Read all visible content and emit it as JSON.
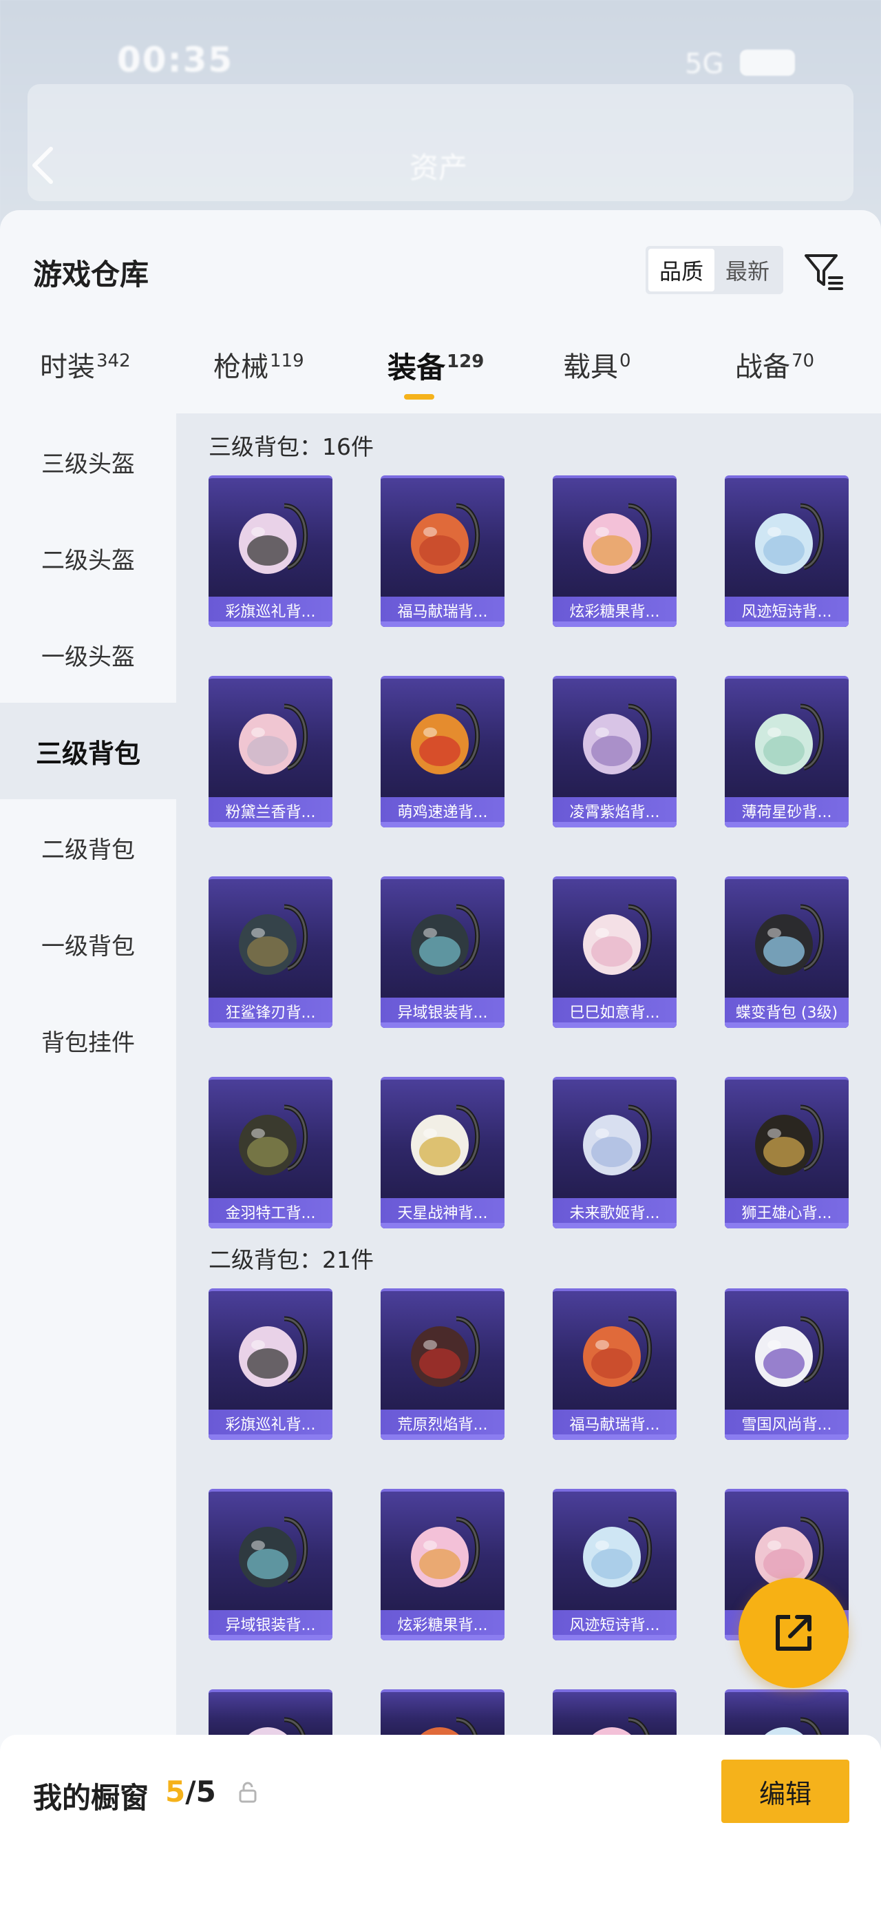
{
  "status_bar": {
    "time": "00:35",
    "network": "5G",
    "battery": "24"
  },
  "header": {
    "title": "资产"
  },
  "warehouse": {
    "title": "游戏仓库",
    "sort_options": [
      "品质",
      "最新"
    ],
    "active_sort": "品质"
  },
  "tabs": [
    {
      "label": "时装",
      "count": "342"
    },
    {
      "label": "枪械",
      "count": "119"
    },
    {
      "label": "装备",
      "count": "129"
    },
    {
      "label": "载具",
      "count": "0"
    },
    {
      "label": "战备",
      "count": "70"
    }
  ],
  "active_tab": "装备",
  "sidebar": {
    "items": [
      "三级头盔",
      "二级头盔",
      "一级头盔",
      "三级背包",
      "二级背包",
      "一级背包",
      "背包挂件"
    ],
    "active": "三级背包"
  },
  "sections": [
    {
      "title": "三级背包：16件",
      "items": [
        "彩旗巡礼背...",
        "福马献瑞背...",
        "炫彩糖果背...",
        "风迹短诗背...",
        "粉黛兰香背...",
        "萌鸡速递背...",
        "凌霄紫焰背...",
        "薄荷星砂背...",
        "狂鲨锋刃背...",
        "异域银装背...",
        "巳巳如意背...",
        "蝶变背包 (3级)",
        "金羽特工背...",
        "天星战神背...",
        "未来歌姬背...",
        "狮王雄心背..."
      ]
    },
    {
      "title": "二级背包：21件",
      "items": [
        "彩旗巡礼背...",
        "荒原烈焰背...",
        "福马献瑞背...",
        "雪国风尚背...",
        "异域银装背...",
        "炫彩糖果背...",
        "风迹短诗背...",
        ""
      ]
    }
  ],
  "showcase": {
    "title": "我的橱窗",
    "used": "5",
    "total": "/5",
    "edit_label": "编辑"
  },
  "colors": {
    "accent": "#f5b21b",
    "card_top": "#4b3f9a",
    "card_bottom": "#1d1842",
    "label_bar": "#6a5ad6"
  }
}
